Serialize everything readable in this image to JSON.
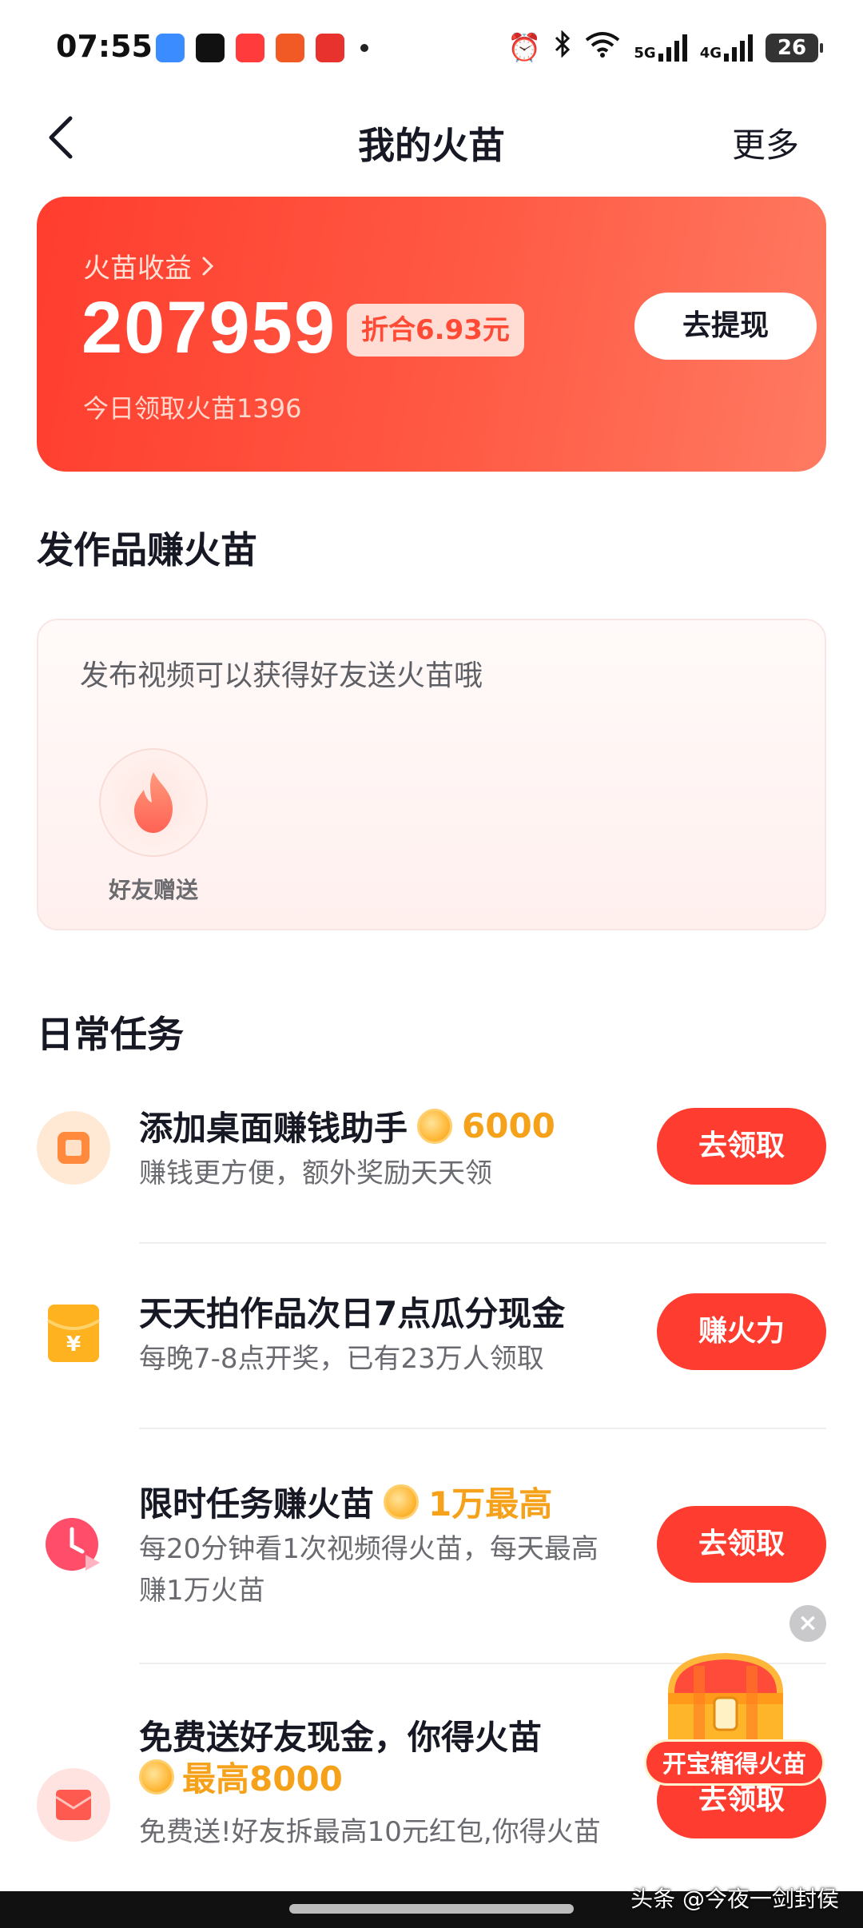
{
  "status_bar": {
    "time": "07:55",
    "network_1": "5G",
    "network_2": "4G",
    "battery": "26"
  },
  "nav": {
    "title": "我的火苗",
    "more": "更多"
  },
  "earnings": {
    "label": "火苗收益",
    "value": "207959",
    "equivalent": "折合6.93元",
    "today": "今日领取火苗1396",
    "withdraw_button": "去提现"
  },
  "works_section": {
    "title": "发作品赚火苗",
    "hint": "发布视频可以获得好友送火苗哦",
    "friend_label": "好友赠送"
  },
  "daily_section": {
    "title": "日常任务"
  },
  "tasks": [
    {
      "title": "添加桌面赚钱助手",
      "reward": "6000",
      "desc": "赚钱更方便，额外奖励天天领",
      "button": "去领取"
    },
    {
      "title": "天天拍作品次日7点瓜分现金",
      "reward": "",
      "desc": "每晚7-8点开奖，已有23万人领取",
      "button": "赚火力"
    },
    {
      "title": "限时任务赚火苗",
      "reward": "1万最高",
      "desc": "每20分钟看1次视频得火苗，每天最高赚1万火苗",
      "button": "去领取"
    },
    {
      "title": "免费送好友现金，你得火苗",
      "reward": "最高8000",
      "desc": "免费送!好友拆最高10元红包,你得火苗",
      "button": "去领取"
    }
  ],
  "treasure": {
    "label": "开宝箱得火苗",
    "close": "×"
  },
  "watermark": "头条 @今夜一剑封侯"
}
